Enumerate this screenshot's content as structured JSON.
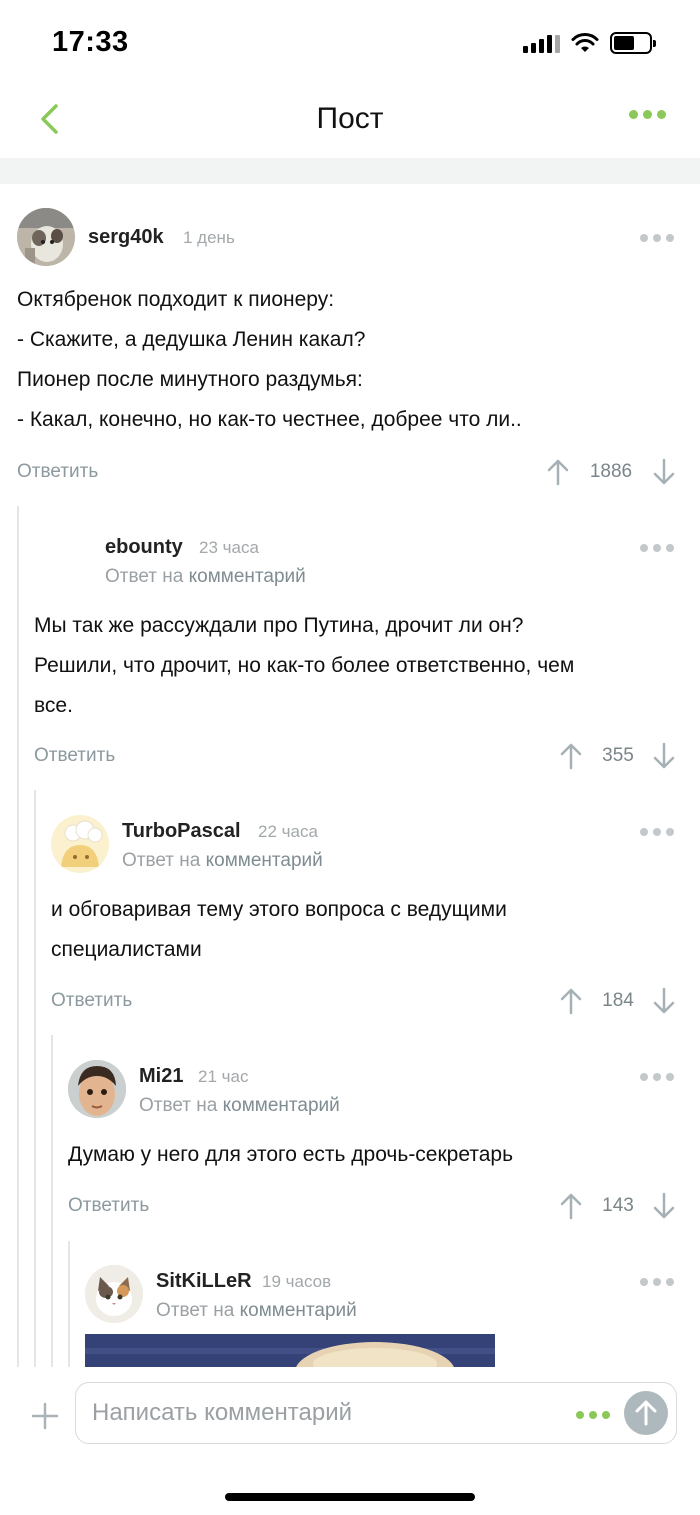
{
  "status_bar": {
    "time": "17:33"
  },
  "nav": {
    "title": "Пост"
  },
  "labels": {
    "reply_to_prefix": "Ответ на",
    "reply_to_link": "комментарий",
    "reply_button": "Ответить"
  },
  "comments": [
    {
      "username": "serg40k",
      "time": "1 день",
      "lines": [
        "Октябренок подходит к пионеру:",
        "- Скажите, а дедушка Ленин какал?",
        "Пионер после минутного раздумья:",
        "- Какал, конечно, но как-то честнее, добрее что ли.."
      ],
      "rating": "1886"
    },
    {
      "username": "ebounty",
      "time": "23 часа",
      "lines": [
        "Мы так же рассуждали про Путина, дрочит ли он?",
        "Решили, что дрочит, но как-то более ответственно, чем",
        "все."
      ],
      "rating": "355"
    },
    {
      "username": "TurboPascal",
      "time": "22 часа",
      "lines": [
        "и обговаривая тему этого вопроса с ведущими",
        "специалистами"
      ],
      "rating": "184"
    },
    {
      "username": "Mi21",
      "time": "21 час",
      "lines": [
        "Думаю у него для этого есть дрочь-секретарь"
      ],
      "rating": "143"
    },
    {
      "username": "SitKiLLeR",
      "time": "19 часов"
    }
  ],
  "compose": {
    "placeholder": "Написать комментарий"
  },
  "colors": {
    "accent": "#8ac858",
    "muted": "#9aa0a3",
    "thread": "#e3e6e8"
  }
}
